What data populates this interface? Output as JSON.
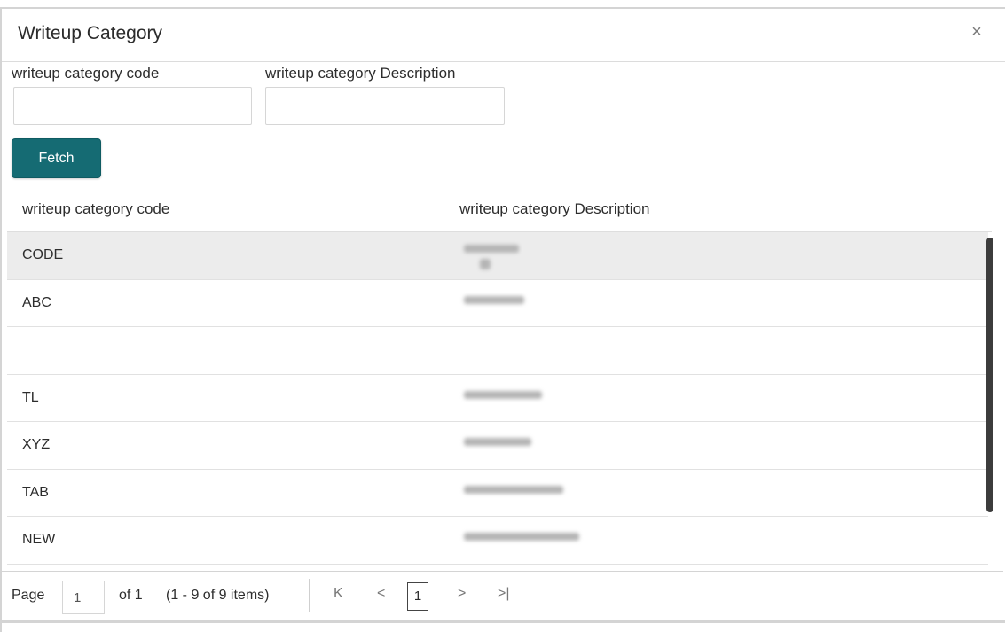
{
  "dialog": {
    "title": "Writeup Category",
    "close_icon": "×"
  },
  "filters": {
    "code_label": "writeup category code",
    "code_value": "",
    "description_label": "writeup category Description",
    "description_value": "",
    "fetch_label": "Fetch"
  },
  "table": {
    "columns": [
      "writeup category code",
      "writeup category Description"
    ],
    "rows": [
      {
        "code": "CODE",
        "description_blurred": true
      },
      {
        "code": "ABC",
        "description_blurred": true
      },
      {
        "code": "",
        "description_blurred": false
      },
      {
        "code": "TL",
        "description_blurred": true
      },
      {
        "code": "XYZ",
        "description_blurred": true
      },
      {
        "code": "TAB",
        "description_blurred": true
      },
      {
        "code": "NEW",
        "description_blurred": true
      }
    ]
  },
  "pagination": {
    "page_label": "Page",
    "page_value": "1",
    "of_label": "of 1",
    "items_label": "(1 - 9 of 9 items)",
    "first_icon": "K",
    "prev_icon": "<",
    "current_page": "1",
    "next_icon": ">",
    "last_icon": ">|"
  }
}
